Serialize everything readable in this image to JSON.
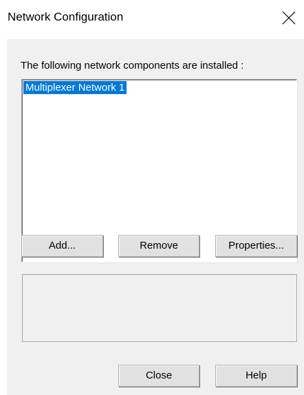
{
  "window": {
    "title": "Network Configuration",
    "close_icon": "close-icon"
  },
  "main": {
    "components_label": "The following network components are installed :",
    "components": [
      {
        "label": "Multiplexer Network 1",
        "selected": true
      }
    ],
    "buttons": {
      "add": "Add...",
      "remove": "Remove",
      "properties": "Properties..."
    },
    "info_text": ""
  },
  "footer": {
    "close": "Close",
    "help": "Help"
  },
  "colors": {
    "selection": "#0078d7",
    "dialog_bg": "#f0f0f0",
    "button_bg": "#e1e1e1"
  }
}
